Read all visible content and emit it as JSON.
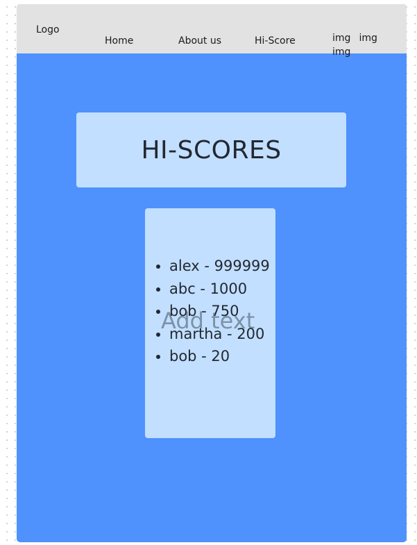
{
  "nav": {
    "logo": "Logo",
    "links": [
      "Home",
      "About us",
      "Hi-Score"
    ],
    "images": [
      "img",
      "img",
      "img"
    ]
  },
  "hero": {
    "title": "HI-SCORES"
  },
  "scores": {
    "items": [
      "alex - 999999",
      "abc - 1000",
      "bob - 750",
      "martha - 200",
      "bob - 20"
    ],
    "placeholder": "Add text"
  },
  "colors": {
    "frame_background": "#4f91fd",
    "navbar_background": "#e2e2e2",
    "card_background": "#c2dfff",
    "text": "#222831"
  }
}
